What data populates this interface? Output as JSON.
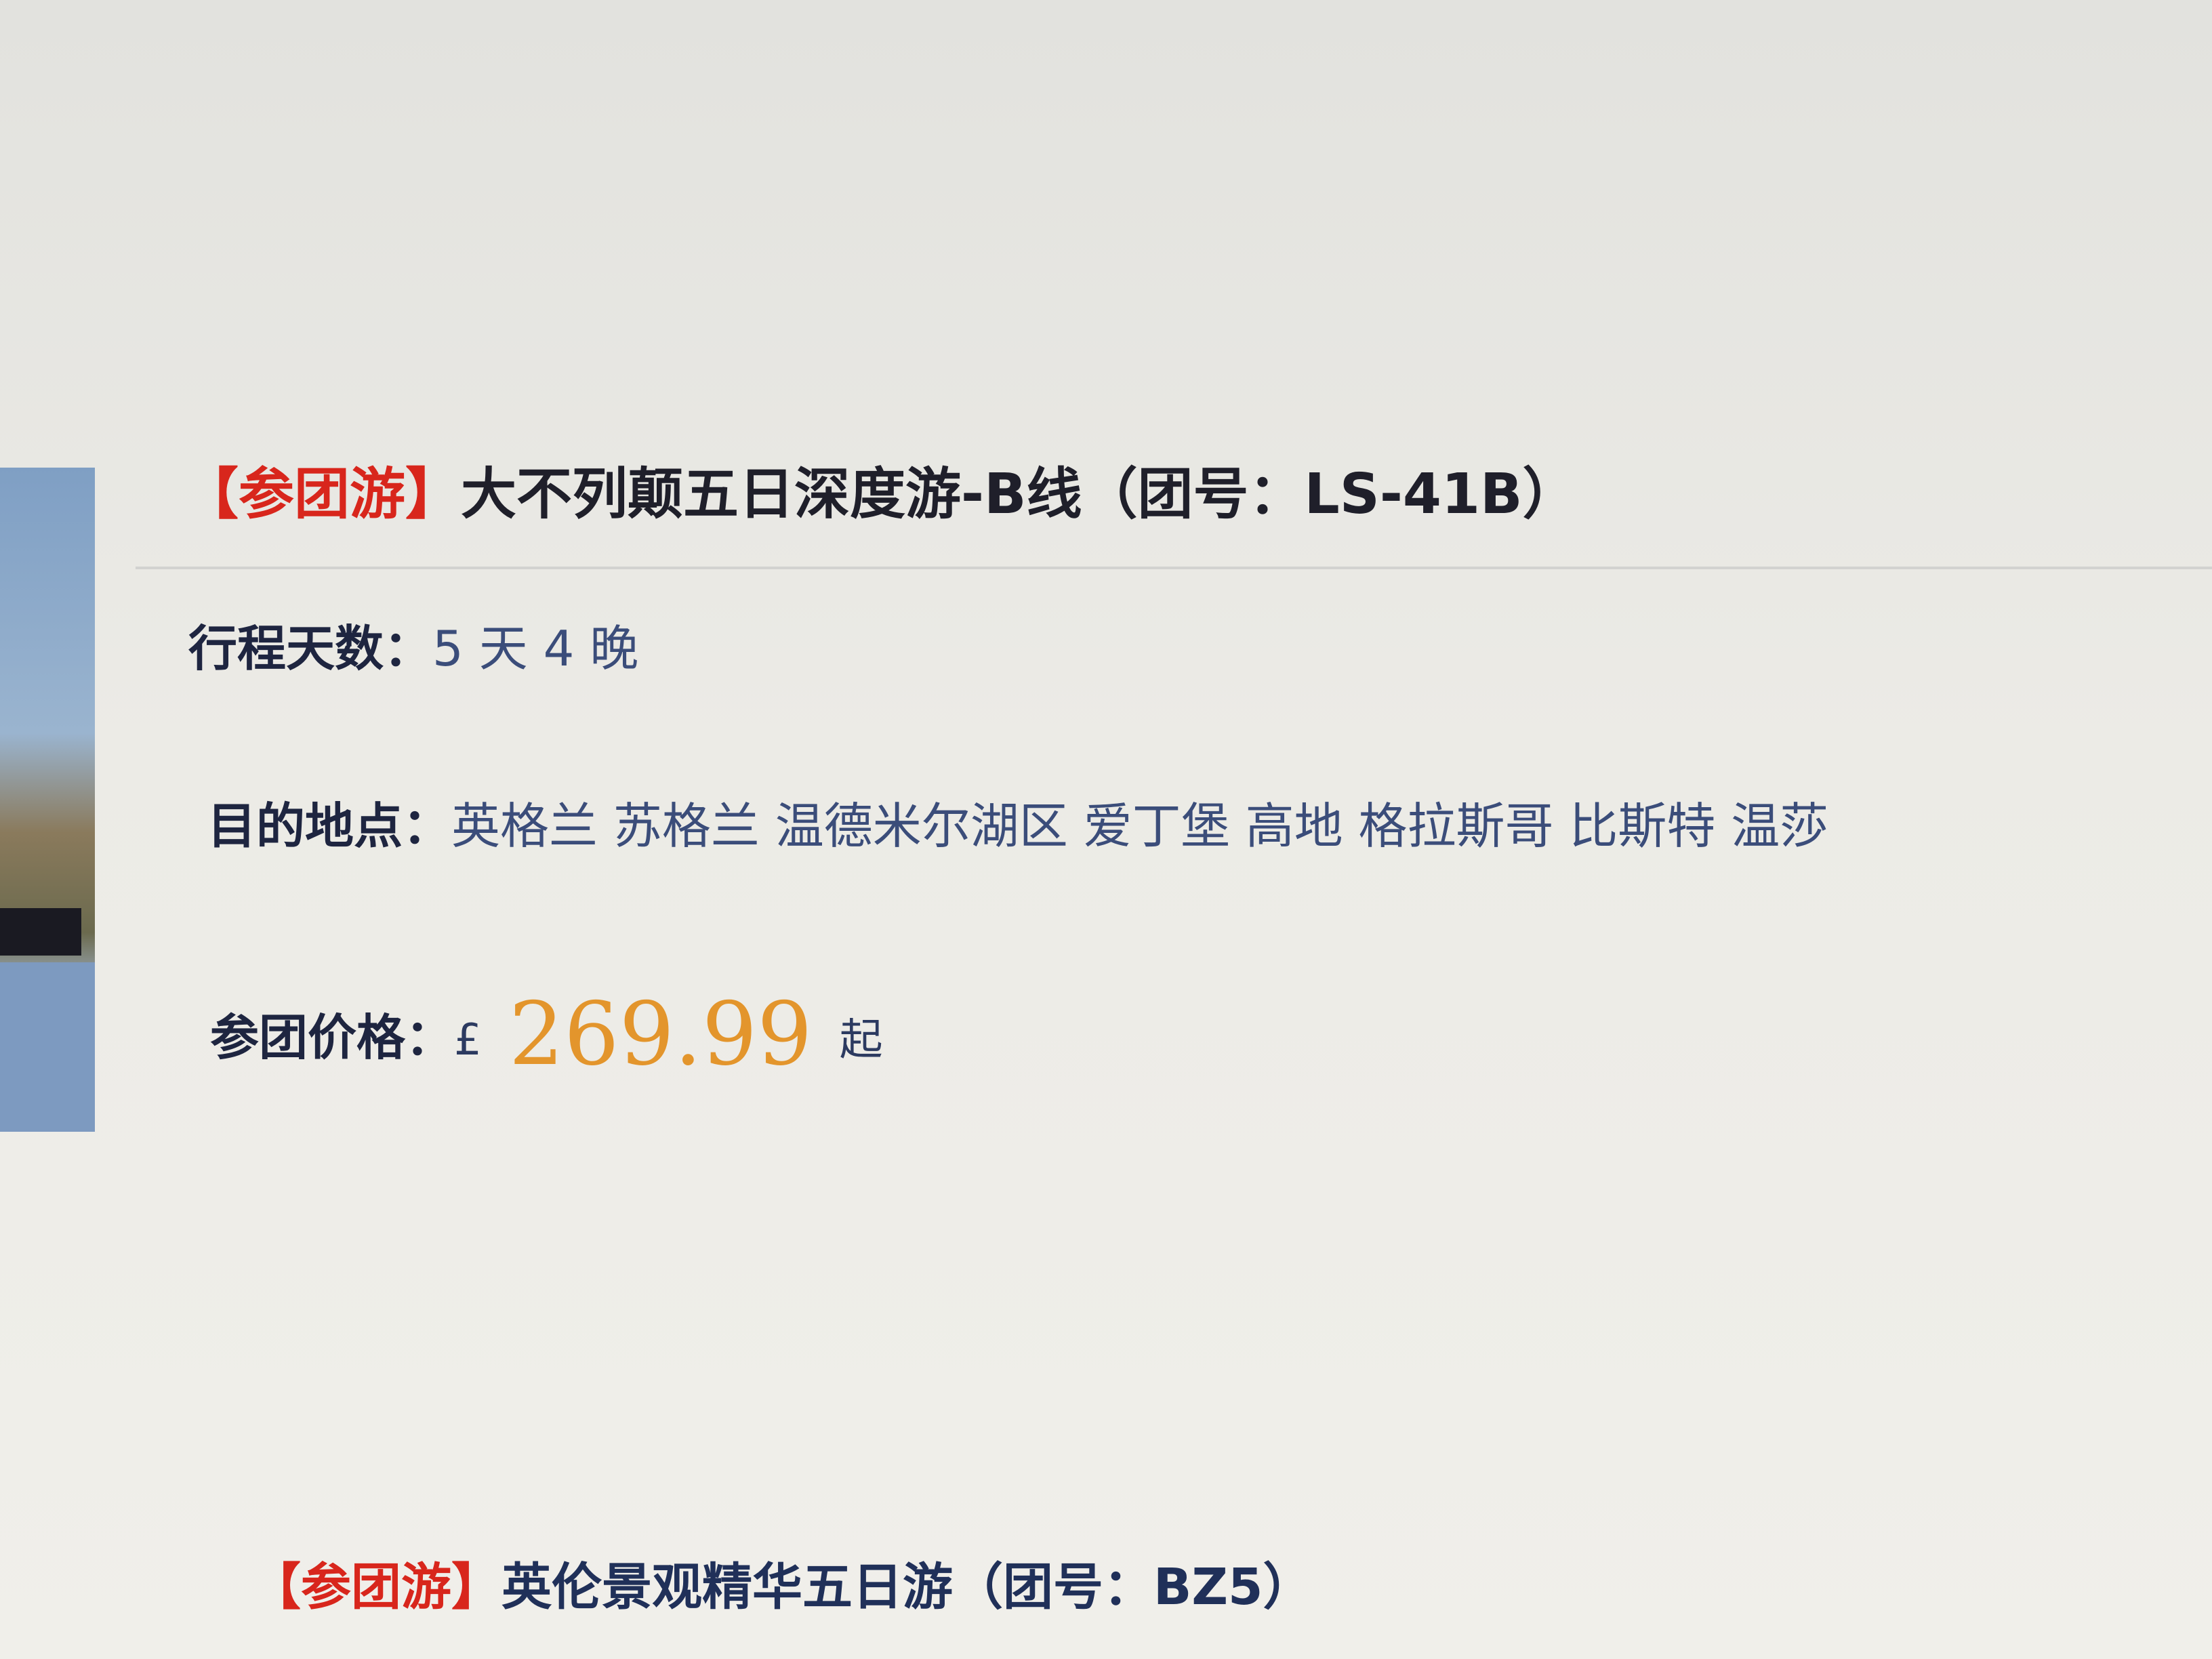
{
  "tour1": {
    "tag": "【参团游】",
    "title": "大不列颠五日深度游-B线（团号：LS-41B）",
    "days_label": "行程天数：",
    "days_value": "5 天 4 晚",
    "dest_label": "目的地点：",
    "dest_value": "英格兰 苏格兰 温德米尔湖区 爱丁堡 高地 格拉斯哥 比斯特 温莎",
    "price_label": "参团价格：",
    "currency": "£",
    "price": "269.99",
    "price_suffix": "起"
  },
  "tour2": {
    "tag": "【参团游】",
    "title": "英伦景观精华五日游（团号：BZ5）"
  }
}
